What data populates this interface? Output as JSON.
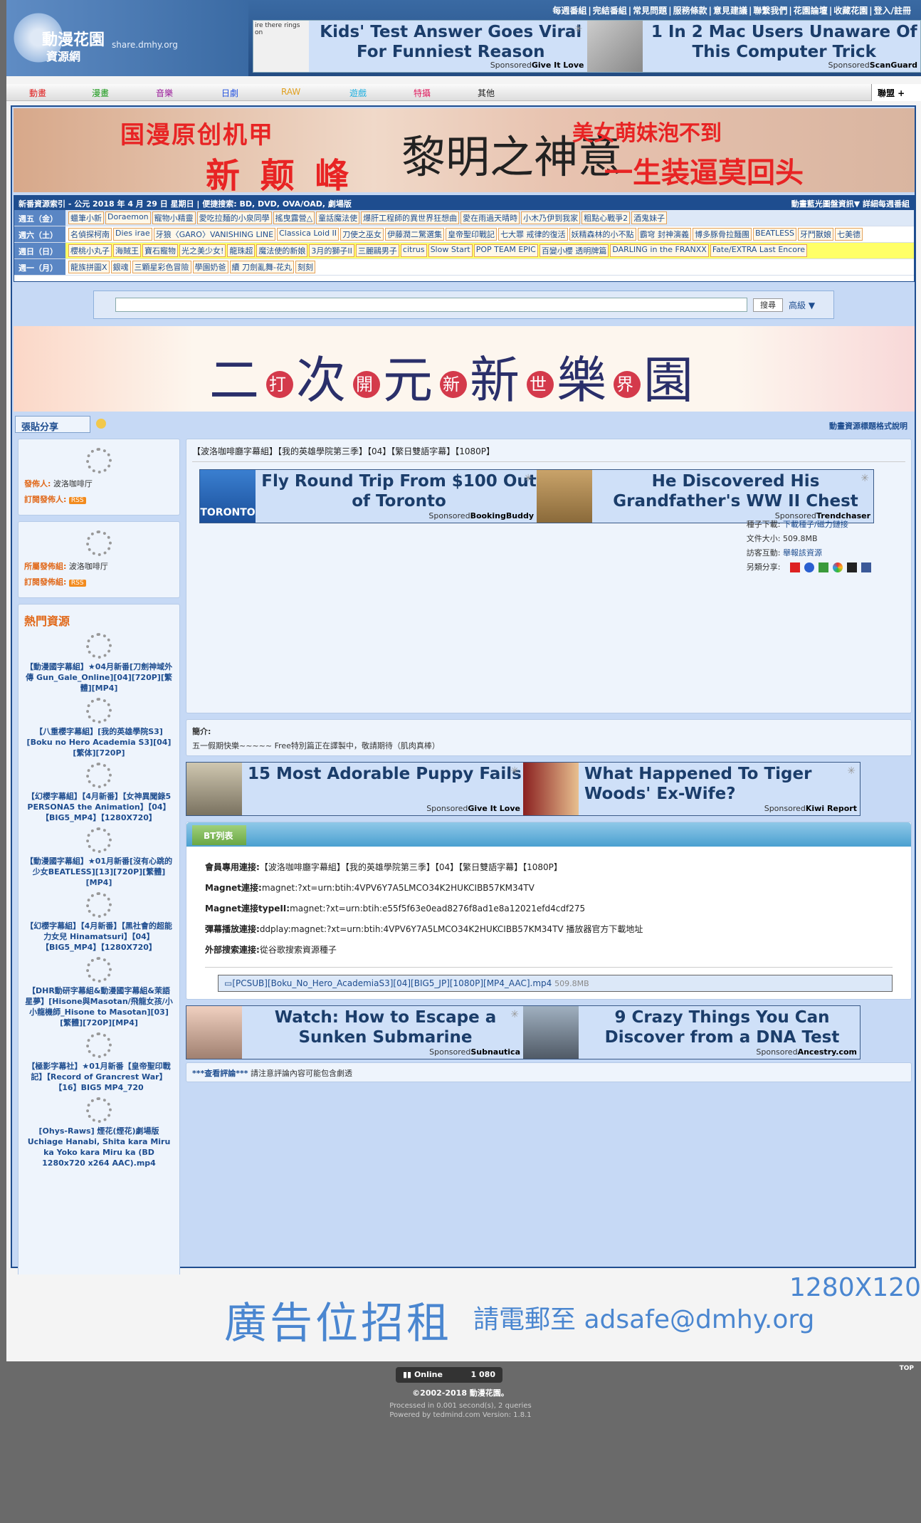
{
  "logo": {
    "name": "動漫花園",
    "sub": "資源網",
    "domain": "share.dmhy.org"
  },
  "toplinks": [
    "每週番組",
    "完結番組",
    "常見問題",
    "服務條款",
    "意見建議",
    "聯繫我們",
    "花園論壇",
    "收藏花園",
    "登入/註冊"
  ],
  "ads_top": [
    {
      "headline": "Kids' Test Answer Goes Viral For Funniest Reason",
      "sponsor": "Give It Love",
      "img": "ire there rings on"
    },
    {
      "headline": "1 In 2 Mac Users Unaware Of This Computer Trick",
      "sponsor": "ScanGuard"
    }
  ],
  "sponsored_label": "Sponsored",
  "nav": [
    {
      "label": "動畫",
      "color": "#e01e1e"
    },
    {
      "label": "漫畫",
      "color": "#1a9a1a"
    },
    {
      "label": "音樂",
      "color": "#9a1a9a"
    },
    {
      "label": "日劇",
      "color": "#2050e0"
    },
    {
      "label": "RAW",
      "color": "#e0a020"
    },
    {
      "label": "遊戲",
      "color": "#20b0e0"
    },
    {
      "label": "特攝",
      "color": "#e01e60"
    },
    {
      "label": "其他",
      "color": "#222222"
    }
  ],
  "union": "聯盟 +",
  "banner1": {
    "a": "国漫原创机甲",
    "b": "新 颠 峰",
    "c": "黎明之神意",
    "d": "美女萌妹泡不到",
    "e": "一生装逼莫回头"
  },
  "schedule": {
    "header": "新番資源索引 - 公元 2018 年 4 月 29 日 星期日 | 便捷搜索: BD, DVD, OVA/OAD, 劇場版",
    "right": "動畫藍光圖盤資訊▼  詳細每週番組",
    "rows": [
      {
        "day": "週五（金）",
        "items": [
          "蠟筆小新",
          "Doraemon",
          "寵物小精靈",
          "愛吃拉麵的小泉同學",
          "搖曳露營△",
          "童話魔法使",
          "爆肝工程師的異世界狂想曲",
          "愛在雨過天晴時",
          "小木乃伊到我家",
          "粗點心戰爭2",
          "酒鬼妹子"
        ]
      },
      {
        "day": "週六（土）",
        "items": [
          "名偵探柯南",
          "Dies irae",
          "牙狼〈GARO〉VANISHING LINE",
          "Classica Loid II",
          "刀使之巫女",
          "伊藤潤二驚選集",
          "皇帝聖印戰記",
          "七大罪 戒律的復活",
          "妖精森林的小不點",
          "霸穹 封神演義",
          "博多豚骨拉麵團",
          "BEATLESS",
          "牙鬥獸娘",
          "七美德"
        ]
      },
      {
        "day": "週日（日）",
        "items": [
          "櫻桃小丸子",
          "海賊王",
          "寶石寵物",
          "光之美少女!",
          "龍珠超",
          "魔法使的新娘",
          "3月的獅子II",
          "三麗鷗男子",
          "citrus",
          "Slow Start",
          "POP TEAM EPIC",
          "百變小櫻 透明牌篇",
          "DARLING in the FRANXX",
          "Fate/EXTRA Last Encore"
        ]
      },
      {
        "day": "週一（月）",
        "items": [
          "龍族拼圖X",
          "銀魂",
          "三顆星彩色冒險",
          "學園奶爸",
          "續 刀劍亂舞-花丸",
          "刻刻"
        ]
      }
    ]
  },
  "search": {
    "button": "搜尋",
    "advanced": "高級 ▼"
  },
  "banner2": {
    "chars": [
      "二",
      "次",
      "元",
      "新",
      "樂",
      "園"
    ],
    "circles": [
      "打",
      "開",
      "新",
      "世",
      "界"
    ]
  },
  "tabbar": {
    "tab": "張貼分享",
    "right": "動畫資源標題格式說明"
  },
  "side": {
    "publisher_label": "發佈人:",
    "publisher": "波洛咖啡厅",
    "sub_label": "訂閱發佈人:",
    "group_label": "所屬發佈組:",
    "group": "波洛咖啡厅",
    "sub2_label": "訂閱發佈組:",
    "rss": "RSS",
    "hot_title": "熱門資源",
    "hot": [
      "【動漫國字幕組】★04月新番[刀劍神域外傳 Gun_Gale_Online][04][720P][繁體][MP4]",
      "【八重櫻字幕組】[我的英雄學院S3][Boku no Hero Academia S3][04][繁体][720P]",
      "【幻櫻字幕組】【4月新番】【女神異聞錄5 PERSONA5 the Animation】【04】【BIG5_MP4】【1280X720】",
      "【動漫國字幕組】★01月新番[沒有心跳的少女BEATLESS][13][720P][繁體][MP4]",
      "【幻櫻字幕組】【4月新番】【黑社會的超能力女兒 Hinamatsuri】【04】【BIG5_MP4】【1280X720】",
      "【DHR動研字幕組&動漫國字幕組&茉語星夢】[Hisone與Masotan/飛龍女孩/小小龍機師_Hisone to Masotan][03][繁體][720P][MP4]",
      "【極影字幕社】★01月新番【皇帝聖印戰記】【Record of Grancrest War】【16】BIG5 MP4_720",
      "[Ohys-Raws] 煙花(煙花)劇場版Uchiage Hanabi, Shita kara Miru ka Yoko kara Miru ka (BD 1280x720 x264 AAC).mp4"
    ]
  },
  "main": {
    "title": "【波洛咖啡廳字幕組】【我的英雄學院第三季】【04】【繁日雙語字幕】【1080P】",
    "ads1": [
      {
        "headline": "Fly Round Trip From $100 Out of Toronto",
        "sponsor": "BookingBuddy",
        "img": "TORONTO"
      },
      {
        "headline": "He Discovered His Grandfather's WW II Chest",
        "sponsor": "Trendchaser"
      }
    ],
    "info": {
      "seed_label": "種子下載:",
      "seed": "下載種子/磁力鏈接",
      "size_label": "文件大小:",
      "size": "509.8MB",
      "visit_label": "訪客互動:",
      "visit": "舉報該資源",
      "share_label": "另類分享:"
    },
    "intro_label": "簡介:",
    "intro": "五一假期快樂~~~~~ Free特別篇正在譯製中，敬請期待（肌肉真棒）",
    "ads2": [
      {
        "headline": "15 Most Adorable Puppy Fails",
        "sponsor": "Give It Love"
      },
      {
        "headline": "What Happened To Tiger Woods' Ex-Wife?",
        "sponsor": "Kiwi Report"
      }
    ],
    "bt_label": "BT列表",
    "links": [
      {
        "k": "會員專用連接:",
        "v": "【波洛咖啡廳字幕組】【我的英雄學院第三季】【04】【繁日雙語字幕】【1080P】"
      },
      {
        "k": "Magnet連接:",
        "v": "magnet:?xt=urn:btih:4VPV6Y7A5LMCO34K2HUKCIBB57KM34TV"
      },
      {
        "k": "Magnet連接typeII:",
        "v": "magnet:?xt=urn:btih:e55f5f63e0ead8276f8ad1e8a12021efd4cdf275"
      },
      {
        "k": "彈幕播放連接:",
        "v": "ddplay:magnet:?xt=urn:btih:4VPV6Y7A5LMCO34K2HUKCIBB57KM34TV 播放器官方下載地址"
      },
      {
        "k": "外部搜索連接:",
        "v": "從谷歌搜索資源種子"
      }
    ],
    "file": "[PCSUB][Boku_No_Hero_AcademiaS3][04][BIG5_JP][1080P][MP4_AAC].mp4",
    "file_size": "509.8MB",
    "ads3": [
      {
        "headline": "Watch: How to Escape a Sunken Submarine",
        "sponsor": "Subnautica"
      },
      {
        "headline": "9 Crazy Things You Can Discover from a DNA Test",
        "sponsor": "Ancestry.com"
      }
    ],
    "comments_link": "***查看評論***",
    "comments_note": " 請注意評論內容可能包含劇透"
  },
  "adrent": {
    "dim": "1280X120",
    "big": "廣告位招租",
    "small": "請電郵至 adsafe@dmhy.org"
  },
  "footer": {
    "online_label": "Online",
    "online_count": "1 080",
    "top": "TOP",
    "copy": "©2002-2018 動漫花園。",
    "proc1": "Processed in 0.001 second(s), 2 queries",
    "proc2": "Powered by tedmind.com Version: 1.8.1"
  }
}
